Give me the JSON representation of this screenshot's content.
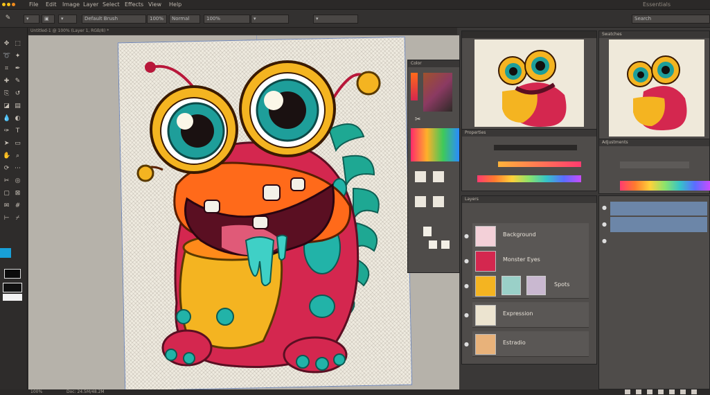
{
  "menu": {
    "items": [
      "File",
      "Edit",
      "Image",
      "Layer",
      "Select",
      "Effects",
      "View",
      "Help"
    ],
    "right_text": "Essentials",
    "search_placeholder": "Search"
  },
  "options": {
    "preset": "Default Brush",
    "opacity": "100%",
    "flow": "100%",
    "mode": "Normal"
  },
  "doc_tab": "Untitled-1 @ 100% (Layer 1, RGB/8) *",
  "panels": {
    "color_title": "Color",
    "properties_title": "Properties",
    "layers_title": "Layers",
    "right_tab_1": "Swatches",
    "right_tab_2": "Adjustments"
  },
  "layers": [
    {
      "name": "Background"
    },
    {
      "name": "Monster Eyes"
    },
    {
      "name": "Spots"
    },
    {
      "name": "Expression"
    },
    {
      "name": "Estradio"
    }
  ],
  "status": {
    "zoom": "100%",
    "info": "Doc: 24.5M/48.2M"
  },
  "colors": {
    "accent": "#6f86b8",
    "monster_red": "#d4274f",
    "monster_orange": "#ff6a1a",
    "monster_yellow": "#f4b421",
    "monster_teal": "#22b3a8"
  }
}
